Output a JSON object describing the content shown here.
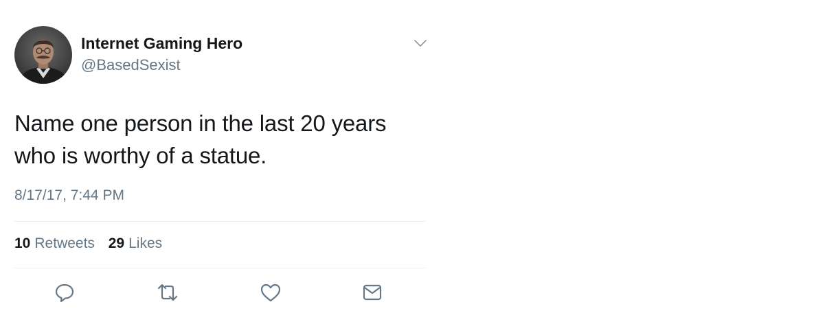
{
  "tweet": {
    "display_name": "Internet Gaming Hero",
    "handle": "@BasedSexist",
    "text_line1": "Name one person in the last 20 years",
    "text_line2": "who is worthy of a statue.",
    "timestamp": "8/17/17, 7:44 PM",
    "retweets_count": "10",
    "retweets_label": "Retweets",
    "likes_count": "29",
    "likes_label": "Likes"
  },
  "icons": {
    "caret": "chevron-down-icon",
    "reply": "reply-icon",
    "retweet": "retweet-icon",
    "like": "heart-icon",
    "message": "envelope-icon"
  },
  "colors": {
    "text_primary": "#14171a",
    "text_secondary": "#657786",
    "divider": "#e6ecf0",
    "icon": "#657786"
  }
}
